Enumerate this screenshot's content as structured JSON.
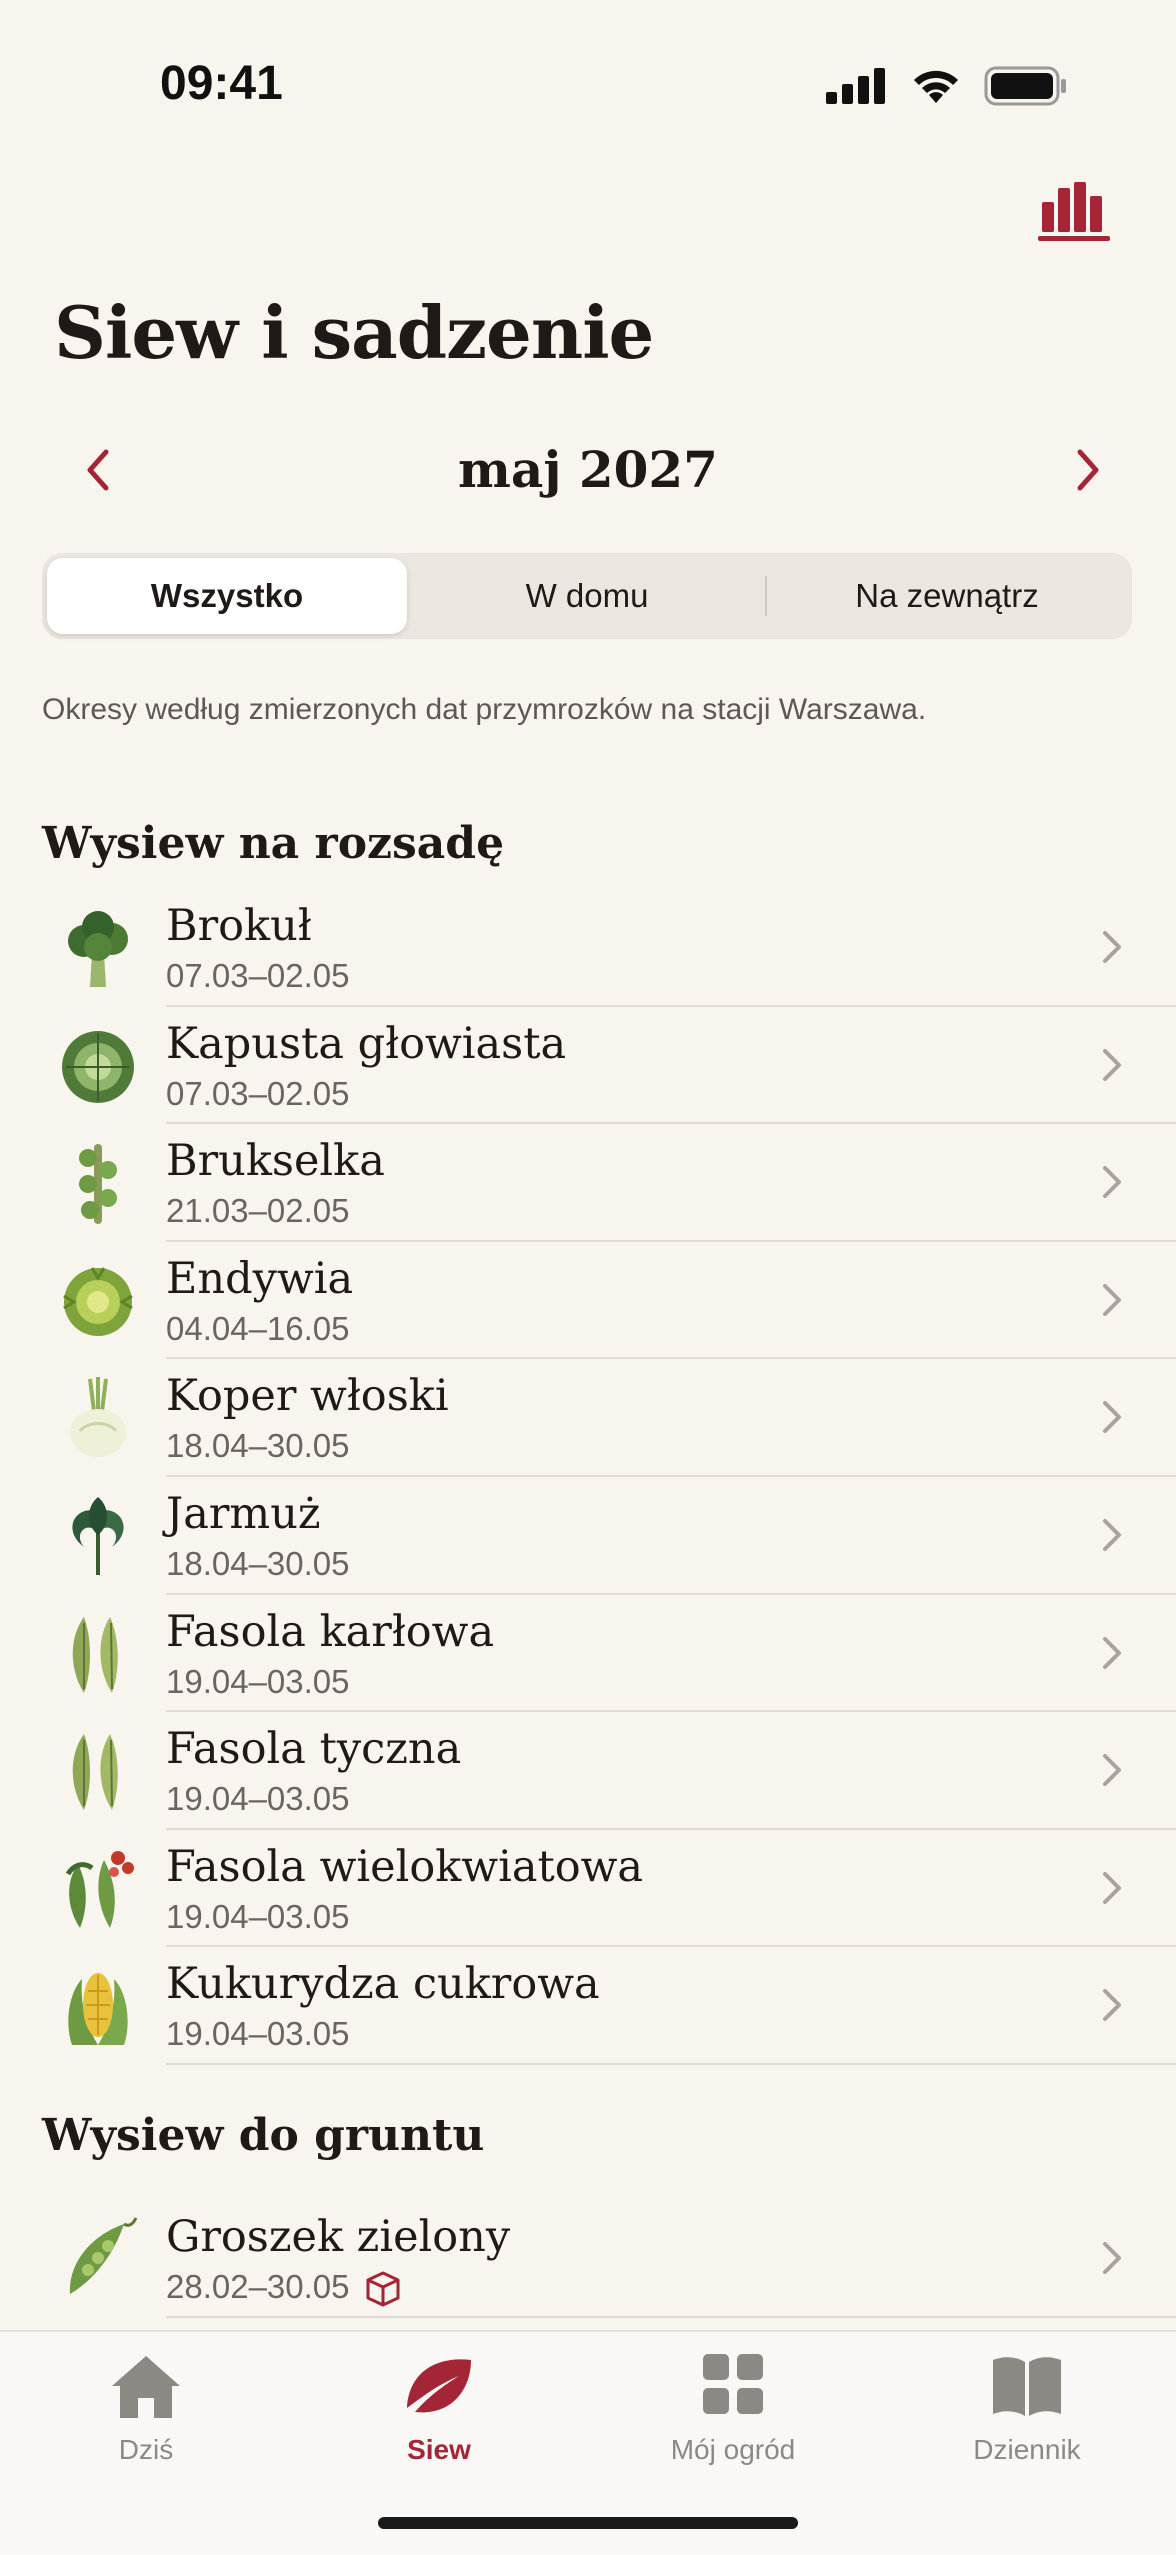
{
  "status_bar": {
    "time": "09:41"
  },
  "header": {
    "title": "Siew i sadzenie",
    "stats_icon": "bar-chart-icon"
  },
  "month_nav": {
    "label": "maj 2027"
  },
  "segments": [
    "Wszystko",
    "W domu",
    "Na zewnątrz"
  ],
  "info": "Okresy według zmierzonych dat przymrozków na stacji Warszawa.",
  "sections": [
    {
      "title": "Wysiew na rozsadę",
      "items": [
        {
          "name": "Brokuł",
          "range": "07.03–02.05",
          "icon": "broccoli-icon"
        },
        {
          "name": "Kapusta głowiasta",
          "range": "07.03–02.05",
          "icon": "cabbage-icon"
        },
        {
          "name": "Brukselka",
          "range": "21.03–02.05",
          "icon": "brussels-sprouts-icon"
        },
        {
          "name": "Endywia",
          "range": "04.04–16.05",
          "icon": "endive-icon"
        },
        {
          "name": "Koper włoski",
          "range": "18.04–30.05",
          "icon": "fennel-icon"
        },
        {
          "name": "Jarmuż",
          "range": "18.04–30.05",
          "icon": "kale-icon"
        },
        {
          "name": "Fasola karłowa",
          "range": "19.04–03.05",
          "icon": "bean-pod-icon"
        },
        {
          "name": "Fasola tyczna",
          "range": "19.04–03.05",
          "icon": "bean-pod-icon"
        },
        {
          "name": "Fasola wielokwiatowa",
          "range": "19.04–03.05",
          "icon": "runner-bean-icon"
        },
        {
          "name": "Kukurydza cukrowa",
          "range": "19.04–03.05",
          "icon": "corn-icon"
        }
      ]
    },
    {
      "title": "Wysiew do gruntu",
      "items": [
        {
          "name": "Groszek zielony",
          "range": "28.02–30.05",
          "icon": "pea-pod-icon",
          "badge": "seed-packet-icon"
        }
      ]
    }
  ],
  "tabs": [
    {
      "label": "Dziś",
      "icon": "home-icon"
    },
    {
      "label": "Siew",
      "icon": "leaf-icon",
      "active": true
    },
    {
      "label": "Mój ogród",
      "icon": "grid-icon"
    },
    {
      "label": "Dziennik",
      "icon": "book-icon"
    }
  ],
  "colors": {
    "accent": "#a32536",
    "background": "#f8f4ee"
  }
}
